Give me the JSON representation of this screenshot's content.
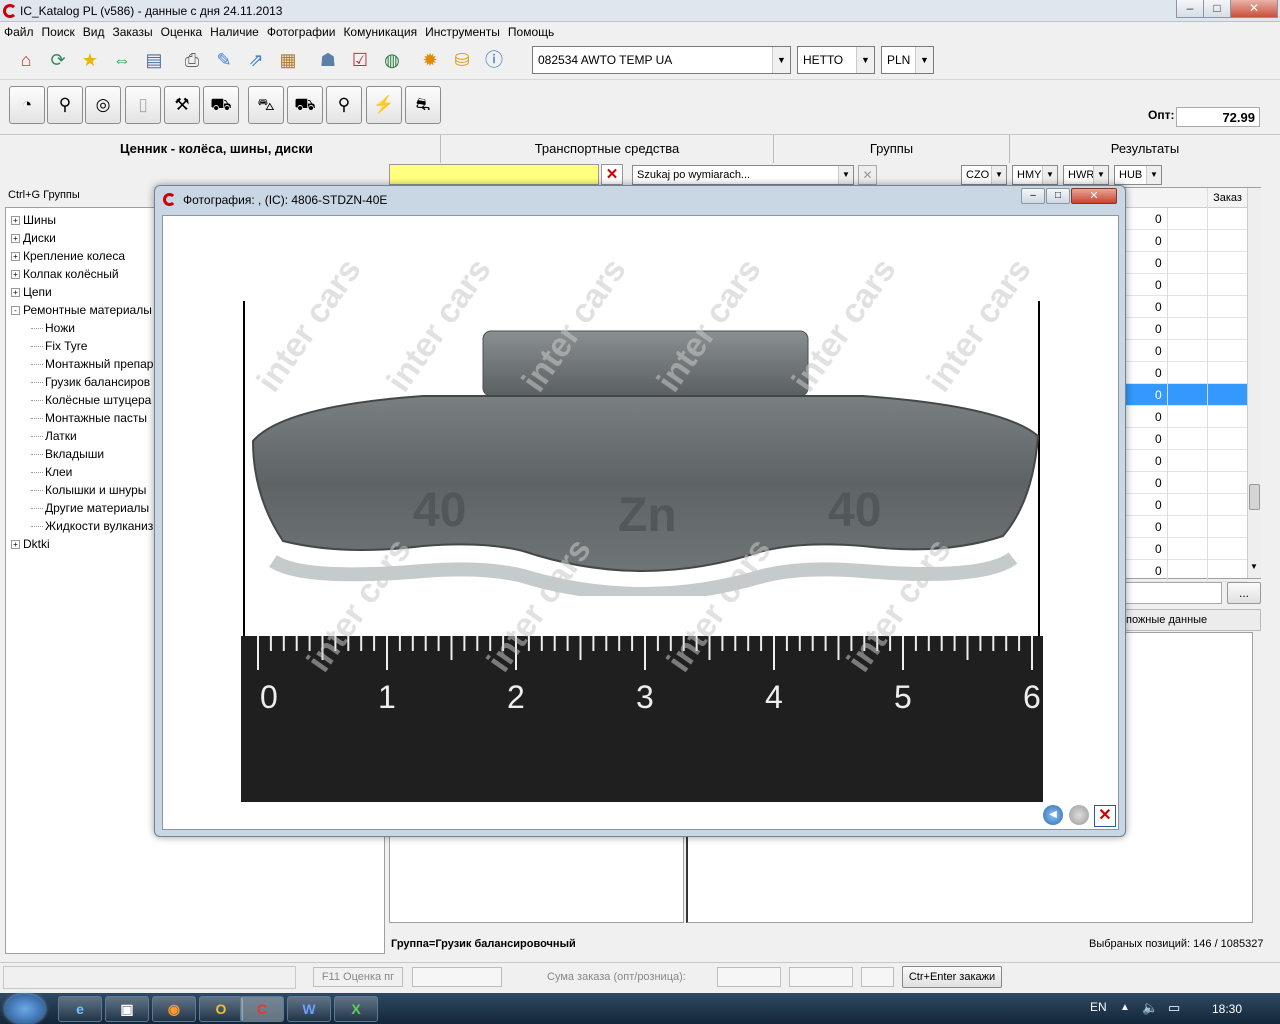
{
  "window": {
    "title": "IC_Katalog PL (v586) - данные с дня 24.11.2013"
  },
  "menu": [
    "Файл",
    "Поиск",
    "Вид",
    "Заказы",
    "Оценка",
    "Наличие",
    "Фотографии",
    "Комуникация",
    "Инструменты",
    "Помощь"
  ],
  "toolbar": {
    "customer": "082534  AWTO TEMP UA",
    "price_type": "НЕТТО",
    "currency": "PLN",
    "opt_label": "Опт:",
    "opt_value": "72.99"
  },
  "tabs": {
    "pricelist": "Ценник - колёса, шины, диски",
    "vehicles": "Транспортные средства",
    "groups": "Группы",
    "results": "Результаты"
  },
  "filters": {
    "search_placeholder": "Szukaj po wymiarach...",
    "chips": [
      "CZO",
      "HMY",
      "HWR",
      "HUB"
    ]
  },
  "tree": {
    "hint": "Ctrl+G Группы",
    "items": [
      {
        "label": "Шины",
        "level": 0,
        "exp": "+"
      },
      {
        "label": "Диски",
        "level": 0,
        "exp": "+"
      },
      {
        "label": "Крепление колеса",
        "level": 0,
        "exp": "+"
      },
      {
        "label": "Колпак колёсный",
        "level": 0,
        "exp": "+"
      },
      {
        "label": "Цепи",
        "level": 0,
        "exp": "+"
      },
      {
        "label": "Ремонтные материалы",
        "level": 0,
        "exp": "-"
      },
      {
        "label": "Ножи",
        "level": 1
      },
      {
        "label": "Fix Tyre",
        "level": 1
      },
      {
        "label": "Монтажный препар",
        "level": 1
      },
      {
        "label": "Грузик балансиров",
        "level": 1
      },
      {
        "label": "Колёсные штуцера",
        "level": 1
      },
      {
        "label": "Монтажные пасты",
        "level": 1
      },
      {
        "label": "Латки",
        "level": 1
      },
      {
        "label": "Вкладыши",
        "level": 1
      },
      {
        "label": "Клеи",
        "level": 1
      },
      {
        "label": "Колышки и шнуры",
        "level": 1
      },
      {
        "label": "Другие материалы",
        "level": 1
      },
      {
        "label": "Жидкости вулканиз",
        "level": 1
      },
      {
        "label": "Dktki",
        "level": 0,
        "exp": "+"
      }
    ]
  },
  "grid": {
    "order_header": "Заказ",
    "values": [
      "0",
      "0",
      "0",
      "0",
      "0",
      "0",
      "0",
      "0",
      "0",
      "0",
      "0",
      "0",
      "0",
      "0",
      "0",
      "0",
      "0"
    ],
    "selected_index": 8
  },
  "right_panel": {
    "related_label": "пожные данные",
    "ellipsis": "..."
  },
  "dialog": {
    "title": "Фотография: , (IC): 4806-STDZN-40E",
    "weight_marks": [
      "40",
      "Zn",
      "40"
    ],
    "ruler_labels": [
      "0",
      "1",
      "2",
      "3",
      "4",
      "5",
      "6"
    ],
    "watermark": "inter cars"
  },
  "status": {
    "group": "Группа=Грузик балансировочный",
    "selected": "Выбраных позиций: 146 / 1085327",
    "f11": "F11 Оценка пг",
    "order_sum_label": "Сума заказа (опт/розница):",
    "order_button": "Ctr+Enter закажи"
  },
  "taskbar": {
    "lang": "EN",
    "time": "18:30"
  }
}
